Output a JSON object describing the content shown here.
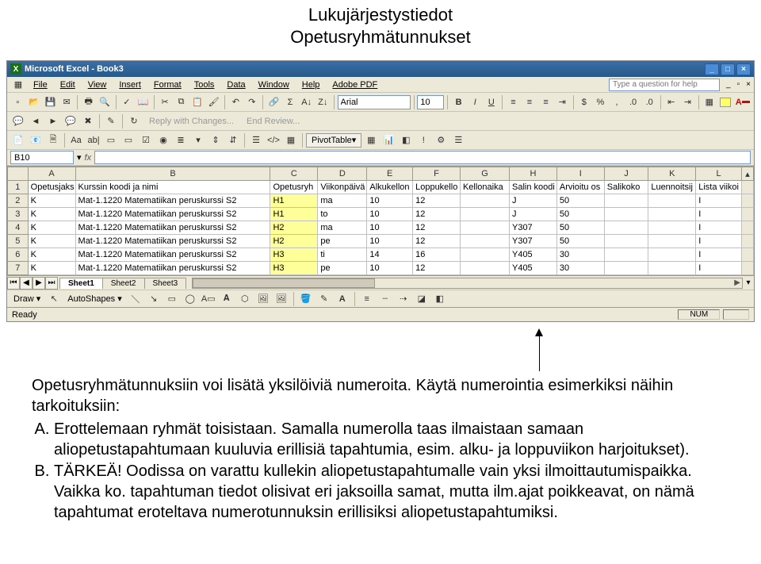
{
  "heading": {
    "line1": "Lukujärjestystiedot",
    "line2": "Opetusryhmätunnukset"
  },
  "titlebar": {
    "app": "Microsoft Excel - Book3"
  },
  "menubar": {
    "items": [
      "File",
      "Edit",
      "View",
      "Insert",
      "Format",
      "Tools",
      "Data",
      "Window",
      "Help",
      "Adobe PDF"
    ],
    "help_placeholder": "Type a question for help"
  },
  "format_toolbar": {
    "font": "Arial",
    "size": "10"
  },
  "pivot_label": "PivotTable",
  "review_toolbar": {
    "reply": "Reply with Changes...",
    "end": "End Review..."
  },
  "namebox": "B10",
  "columns": [
    "A",
    "B",
    "C",
    "D",
    "E",
    "F",
    "G",
    "H",
    "I",
    "J",
    "K",
    "L"
  ],
  "header_row": [
    "Opetusjaks",
    "Kurssin koodi ja nimi",
    "Opetusryh",
    "Viikonpäivä",
    "Alkukellon",
    "Loppukello",
    "Kellonaika",
    "Salin koodi",
    "Arvioitu os",
    "Salikoko",
    "Luennoitsij",
    "Lista viikoi"
  ],
  "rows": [
    {
      "n": "2",
      "cells": [
        "K",
        "Mat-1.1220 Matematiikan peruskurssi S2",
        "H1",
        "ma",
        "10",
        "12",
        "",
        "J",
        "50",
        "",
        "",
        "I"
      ]
    },
    {
      "n": "3",
      "cells": [
        "K",
        "Mat-1.1220 Matematiikan peruskurssi S2",
        "H1",
        "to",
        "10",
        "12",
        "",
        "J",
        "50",
        "",
        "",
        "I"
      ]
    },
    {
      "n": "4",
      "cells": [
        "K",
        "Mat-1.1220 Matematiikan peruskurssi S2",
        "H2",
        "ma",
        "10",
        "12",
        "",
        "Y307",
        "50",
        "",
        "",
        "I"
      ]
    },
    {
      "n": "5",
      "cells": [
        "K",
        "Mat-1.1220 Matematiikan peruskurssi S2",
        "H2",
        "pe",
        "10",
        "12",
        "",
        "Y307",
        "50",
        "",
        "",
        "I"
      ]
    },
    {
      "n": "6",
      "cells": [
        "K",
        "Mat-1.1220 Matematiikan peruskurssi S2",
        "H3",
        "ti",
        "14",
        "16",
        "",
        "Y405",
        "30",
        "",
        "",
        "I"
      ]
    },
    {
      "n": "7",
      "cells": [
        "K",
        "Mat-1.1220 Matematiikan peruskurssi S2",
        "H3",
        "pe",
        "10",
        "12",
        "",
        "Y405",
        "30",
        "",
        "",
        "I"
      ]
    }
  ],
  "sheet_tabs": [
    "Sheet1",
    "Sheet2",
    "Sheet3"
  ],
  "drawbar": {
    "draw": "Draw",
    "autoshapes": "AutoShapes"
  },
  "statusbar": {
    "left": "Ready",
    "num": "NUM"
  },
  "body": {
    "intro": "Opetusryhmätunnuksiin voi lisätä yksilöiviä numeroita. Käytä numerointia esimerkiksi näihin tarkoituksiin:",
    "items": [
      "Erottelemaan ryhmät toisistaan. Samalla numerolla taas ilmaistaan samaan aliopetustapahtumaan kuuluvia erillisiä tapahtumia, esim. alku- ja loppuviikon harjoitukset).",
      "TÄRKEÄ! Oodissa on varattu kullekin aliopetustapahtumalle vain yksi ilmoittautumispaikka. Vaikka ko. tapahtuman tiedot olisivat eri jaksoilla samat, mutta ilm.ajat poikkeavat, on nämä tapahtumat eroteltava numerotunnuksin erillisiksi aliopetustapahtumiksi."
    ],
    "labels": [
      "A)",
      "B)"
    ]
  }
}
